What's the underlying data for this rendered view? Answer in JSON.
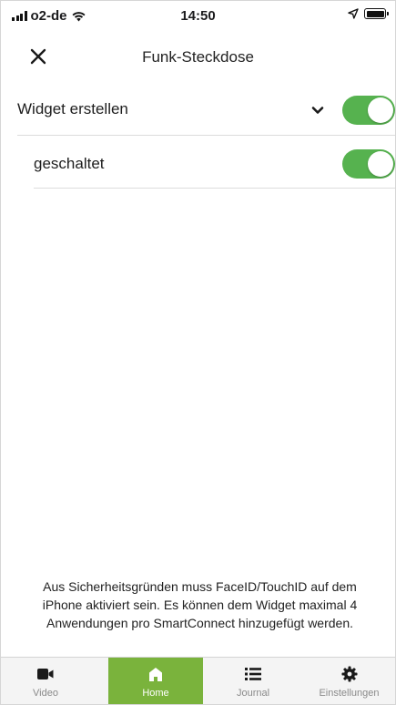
{
  "status_bar": {
    "carrier": "o2-de",
    "time": "14:50"
  },
  "nav": {
    "title": "Funk-Steckdose"
  },
  "rows": {
    "widget": {
      "label": "Widget erstellen",
      "toggle_on": true,
      "expanded": true
    },
    "geschaltet": {
      "label": "geschaltet",
      "toggle_on": true
    }
  },
  "info": {
    "text": "Aus Sicherheitsgründen muss FaceID/TouchID auf dem iPhone aktiviert sein. Es können dem Widget maximal 4 Anwendungen pro SmartConnect hinzugefügt werden."
  },
  "tabs": [
    {
      "label": "Video",
      "icon": "video-camera-icon",
      "active": false
    },
    {
      "label": "Home",
      "icon": "home-icon",
      "active": true
    },
    {
      "label": "Journal",
      "icon": "list-icon",
      "active": false
    },
    {
      "label": "Einstellungen",
      "icon": "gear-icon",
      "active": false
    }
  ],
  "colors": {
    "accent_green": "#56b24f",
    "active_tab_green": "#7ab33c"
  }
}
